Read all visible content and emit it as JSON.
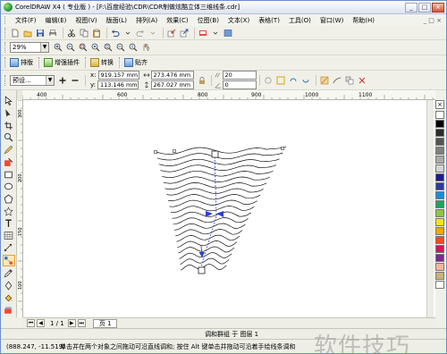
{
  "window": {
    "title": "CorelDRAW X4 ( 专业版 ) - [F:\\百度经验\\CDR\\CDR制做炫酷立体三维线条.cdr]",
    "minimize": "_",
    "maximize": "□",
    "close": "×"
  },
  "menu": {
    "items": [
      "文件(F)",
      "编辑(E)",
      "视图(V)",
      "版面(L)",
      "排列(A)",
      "效果(C)",
      "位图(B)",
      "文本(X)",
      "表格(T)",
      "工具(O)",
      "窗口(W)",
      "帮助(H)"
    ],
    "doc_controls": "_ □ ×"
  },
  "zoom": {
    "value": "29%"
  },
  "toolbar3": {
    "items": [
      "排版",
      "增强插件",
      "转换",
      "贴齐"
    ]
  },
  "property_bar": {
    "preset": "预设...",
    "x_label": "x:",
    "y_label": "y:",
    "x": "919.157 mm",
    "y": "113.146 mm",
    "w": "273.476 mm",
    "h": "267.027 mm",
    "steps": "20",
    "angle": "0"
  },
  "ruler": {
    "top_ticks": [
      "400",
      "600",
      "800",
      "900",
      "1000",
      "1100"
    ],
    "top_unit": "毫米",
    "left_ticks": [
      "300",
      "200",
      "150",
      "100"
    ]
  },
  "page_nav": {
    "counter": "1 / 1",
    "page_tab": "页 1"
  },
  "status": {
    "object_info": "调和群组 于 图层 1",
    "coords": "(888.247, -11.519)",
    "hint": "单击并在两个对象之间拖动可沿直线调和; 按住 Alt 键单击并拖动可沿着手绘线条调和"
  },
  "palette": {
    "colors": [
      "#ffffff",
      "#000000",
      "#2b2b2b",
      "#555555",
      "#7f7f7f",
      "#aaaaaa",
      "#d4d4d4",
      "#1c1c8a",
      "#2e3b9e",
      "#1b8cd4",
      "#1fa35a",
      "#8ec63f",
      "#f2e600",
      "#f7a600",
      "#e8501c",
      "#d4145a",
      "#7d2a8c",
      "#f6b79a",
      "#c8b27a",
      "#ffffff"
    ]
  },
  "watermark": "软件技巧"
}
